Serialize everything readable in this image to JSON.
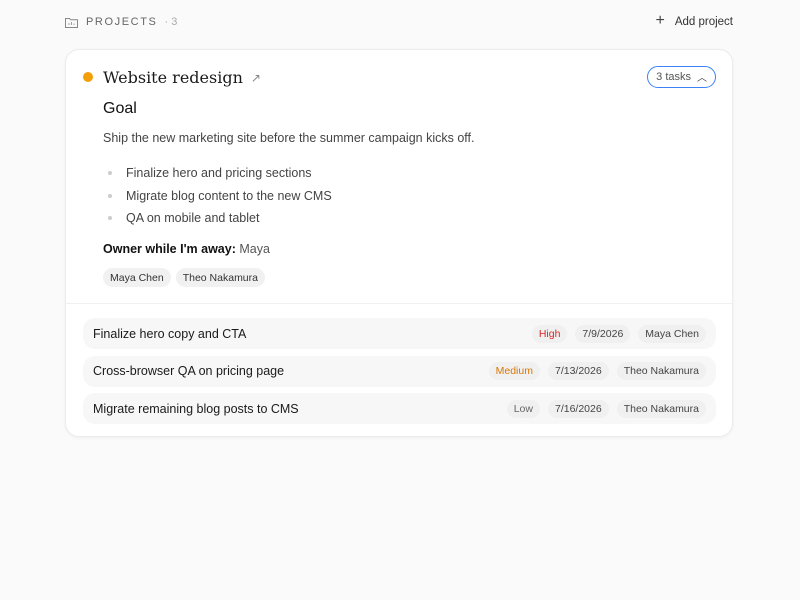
{
  "header": {
    "label": "PROJECTS",
    "count": "· 3",
    "add_label": "Add project",
    "folder_icon": "folder-icon",
    "plus_icon": "plus-icon"
  },
  "project": {
    "title": "Website redesign",
    "status_color": "#f59e0b",
    "tasks_toggle": "3 tasks",
    "goal_heading": "Goal",
    "goal_description": "Ship the new marketing site before the summer campaign kicks off.",
    "goal_items": [
      "Finalize hero and pricing sections",
      "Migrate blog content to the new CMS",
      "QA on mobile and tablet"
    ],
    "owner_label": "Owner while I'm away:",
    "owner_name": "Maya",
    "members": [
      "Maya Chen",
      "Theo Nakamura"
    ]
  },
  "tasks": [
    {
      "title": "Finalize hero copy and CTA",
      "priority": "High",
      "priority_color": "#dc2626",
      "date": "7/9/2026",
      "assignee": "Maya Chen"
    },
    {
      "title": "Cross-browser QA on pricing page",
      "priority": "Medium",
      "priority_color": "#d97706",
      "date": "7/13/2026",
      "assignee": "Theo Nakamura"
    },
    {
      "title": "Migrate remaining blog posts to CMS",
      "priority": "Low",
      "priority_color": "#666666",
      "date": "7/16/2026",
      "assignee": "Theo Nakamura"
    }
  ],
  "colors": {
    "accent": "#3b82f6"
  }
}
